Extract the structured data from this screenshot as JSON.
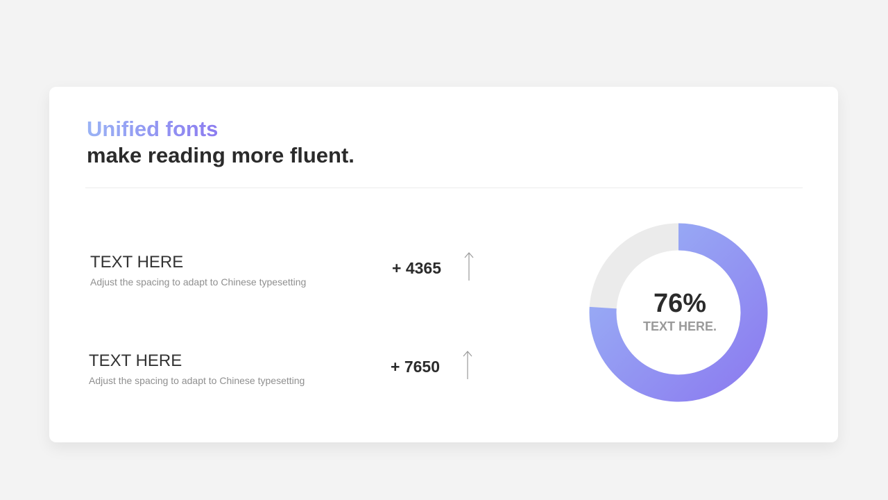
{
  "heading": {
    "accent": "Unified fonts",
    "main": "make reading more fluent."
  },
  "stats": [
    {
      "label": "TEXT HERE",
      "description": "Adjust the spacing to adapt to Chinese typesetting",
      "value": "+ 4365",
      "trend_icon": "arrow-up-icon"
    },
    {
      "label": "TEXT HERE",
      "description": "Adjust the spacing to adapt to Chinese typesetting",
      "value": "+ 7650",
      "trend_icon": "arrow-up-icon"
    }
  ],
  "donut": {
    "value_text": "76%",
    "label": "TEXT HERE."
  },
  "colors": {
    "gradient_start": "#9ab3f5",
    "gradient_end": "#8c7cf0",
    "track": "#ebebeb",
    "text_dark": "#2b2b2b",
    "text_muted": "#8f8f8f"
  },
  "chart_data": {
    "type": "pie",
    "style": "donut",
    "values": [
      76,
      24
    ],
    "value_text": "76%",
    "label": "TEXT HERE."
  }
}
